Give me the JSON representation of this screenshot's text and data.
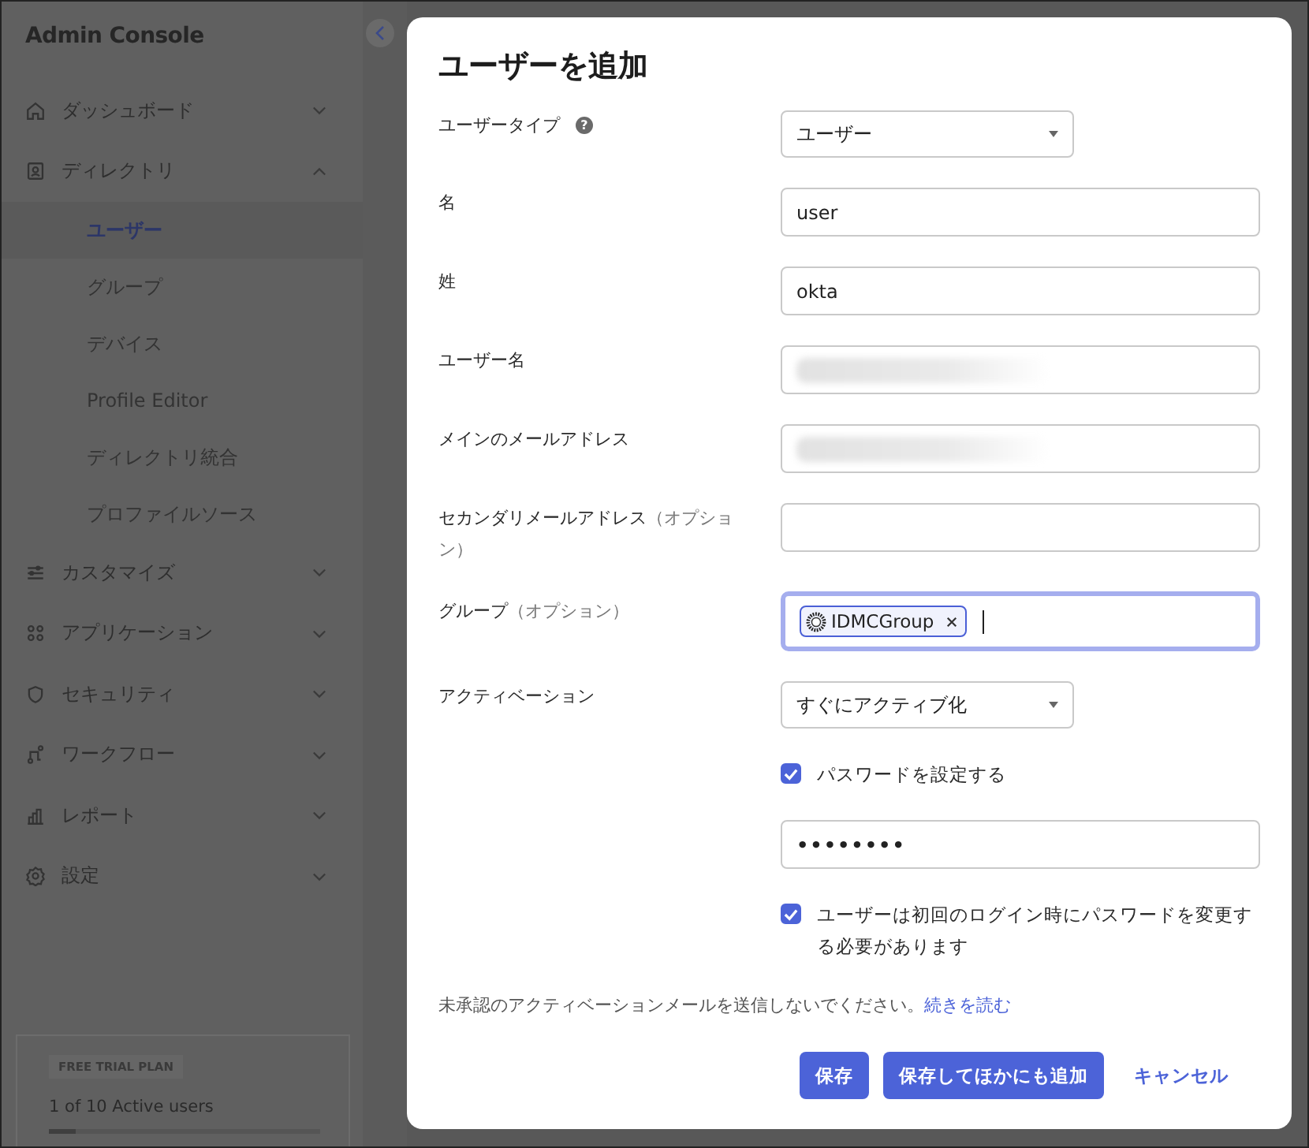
{
  "sidebar": {
    "title": "Admin Console",
    "items": [
      {
        "label": "ダッシュボード",
        "expanded": false
      },
      {
        "label": "ディレクトリ",
        "expanded": true,
        "children": [
          {
            "label": "ユーザー",
            "selected": true
          },
          {
            "label": "グループ",
            "selected": false
          },
          {
            "label": "デバイス",
            "selected": false
          },
          {
            "label": "Profile Editor",
            "selected": false
          },
          {
            "label": "ディレクトリ統合",
            "selected": false
          },
          {
            "label": "プロファイルソース",
            "selected": false
          }
        ]
      },
      {
        "label": "カスタマイズ",
        "expanded": false
      },
      {
        "label": "アプリケーション",
        "expanded": false
      },
      {
        "label": "セキュリティ",
        "expanded": false
      },
      {
        "label": "ワークフロー",
        "expanded": false
      },
      {
        "label": "レポート",
        "expanded": false
      },
      {
        "label": "設定",
        "expanded": false
      }
    ],
    "plan": {
      "badge": "FREE TRIAL PLAN",
      "usage": "1 of 10 Active users",
      "level": 0.1
    }
  },
  "dialog": {
    "title": "ユーザーを追加",
    "fields": [
      {
        "kind": "select",
        "label": "ユーザータイプ",
        "help": "?",
        "value": "ユーザー"
      },
      {
        "kind": "text",
        "label": "名",
        "value": "user"
      },
      {
        "kind": "text",
        "label": "姓",
        "value": "okta"
      },
      {
        "kind": "text",
        "label": "ユーザー名",
        "redacted": true
      },
      {
        "kind": "text",
        "label": "メインのメールアドレス",
        "redacted": true
      },
      {
        "kind": "text",
        "label": "セカンダリメールアドレス",
        "note": "（オプション）"
      },
      {
        "kind": "tags",
        "label": "グループ",
        "note": "（オプション）",
        "tags": [
          "IDMCGroup"
        ]
      },
      {
        "kind": "select",
        "label": "アクティベーション",
        "value": "すぐにアクティブ化"
      },
      {
        "kind": "checkbox",
        "label": "パスワードを設定する",
        "checked": true
      },
      {
        "kind": "password",
        "value": "••••••••"
      },
      {
        "kind": "checkbox",
        "label": "ユーザーは初回のログイン時にパスワードを変更する必要があります",
        "checked": true
      }
    ],
    "notice": {
      "text": "未承認のアクティベーションメールを送信しないでください。",
      "link": "続きを読む"
    },
    "buttons": [
      {
        "label": "保存",
        "kind": "primary"
      },
      {
        "label": "保存してほかにも追加",
        "kind": "primary"
      },
      {
        "label": "キャンセル",
        "kind": "link"
      }
    ]
  }
}
